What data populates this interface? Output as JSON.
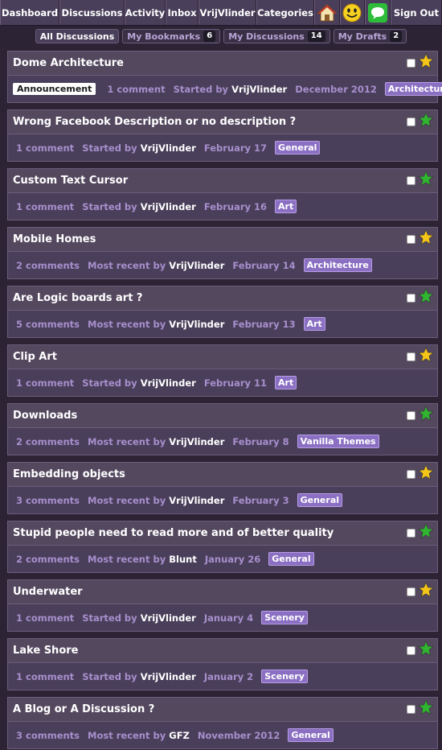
{
  "nav": {
    "items": [
      "Dashboard",
      "Discussions",
      "Activity",
      "Inbox",
      "VrijVlinder",
      "Categories"
    ],
    "icons": [
      "home-icon",
      "smiley-icon",
      "chat-icon"
    ],
    "sign_out": "Sign Out"
  },
  "tabs": [
    {
      "label": "All Discussions",
      "count": ""
    },
    {
      "label": "My Bookmarks",
      "count": "6"
    },
    {
      "label": "My Discussions",
      "count": "14"
    },
    {
      "label": "My Drafts",
      "count": "2"
    }
  ],
  "colors": {
    "star_gold": "#f5c518",
    "star_green": "#2fb52f",
    "category": "#8a6fc2"
  },
  "discussions": [
    {
      "title": "Dome Architecture",
      "badge": "Announcement",
      "comments": "1 comment",
      "by_label": "Started by",
      "author": "VrijVlinder",
      "date": "December 2012",
      "category": "Architecture",
      "star": "gold"
    },
    {
      "title": "Wrong Facebook Description or no description ?",
      "badge": "",
      "comments": "1 comment",
      "by_label": "Started by",
      "author": "VrijVlinder",
      "date": "February 17",
      "category": "General",
      "star": "green"
    },
    {
      "title": "Custom Text Cursor",
      "badge": "",
      "comments": "1 comment",
      "by_label": "Started by",
      "author": "VrijVlinder",
      "date": "February 16",
      "category": "Art",
      "star": "green"
    },
    {
      "title": "Mobile Homes",
      "badge": "",
      "comments": "2 comments",
      "by_label": "Most recent by",
      "author": "VrijVlinder",
      "date": "February 14",
      "category": "Architecture",
      "star": "gold"
    },
    {
      "title": "Are Logic boards art ?",
      "badge": "",
      "comments": "5 comments",
      "by_label": "Most recent by",
      "author": "VrijVlinder",
      "date": "February 13",
      "category": "Art",
      "star": "green"
    },
    {
      "title": "Clip Art",
      "badge": "",
      "comments": "1 comment",
      "by_label": "Started by",
      "author": "VrijVlinder",
      "date": "February 11",
      "category": "Art",
      "star": "gold"
    },
    {
      "title": "Downloads",
      "badge": "",
      "comments": "2 comments",
      "by_label": "Most recent by",
      "author": "VrijVlinder",
      "date": "February 8",
      "category": "Vanilla Themes",
      "star": "green"
    },
    {
      "title": "Embedding objects",
      "badge": "",
      "comments": "3 comments",
      "by_label": "Most recent by",
      "author": "VrijVlinder",
      "date": "February 3",
      "category": "General",
      "star": "gold"
    },
    {
      "title": "Stupid people need to read more and of better quality",
      "badge": "",
      "comments": "2 comments",
      "by_label": "Most recent by",
      "author": "Blunt",
      "date": "January 26",
      "category": "General",
      "star": "green"
    },
    {
      "title": "Underwater",
      "badge": "",
      "comments": "1 comment",
      "by_label": "Started by",
      "author": "VrijVlinder",
      "date": "January 4",
      "category": "Scenery",
      "star": "gold"
    },
    {
      "title": "Lake Shore",
      "badge": "",
      "comments": "1 comment",
      "by_label": "Started by",
      "author": "VrijVlinder",
      "date": "January 2",
      "category": "Scenery",
      "star": "green"
    },
    {
      "title": "A Blog or A Discussion ?",
      "badge": "",
      "comments": "3 comments",
      "by_label": "Most recent by",
      "author": "GFZ",
      "date": "November 2012",
      "category": "General",
      "star": "green"
    }
  ]
}
